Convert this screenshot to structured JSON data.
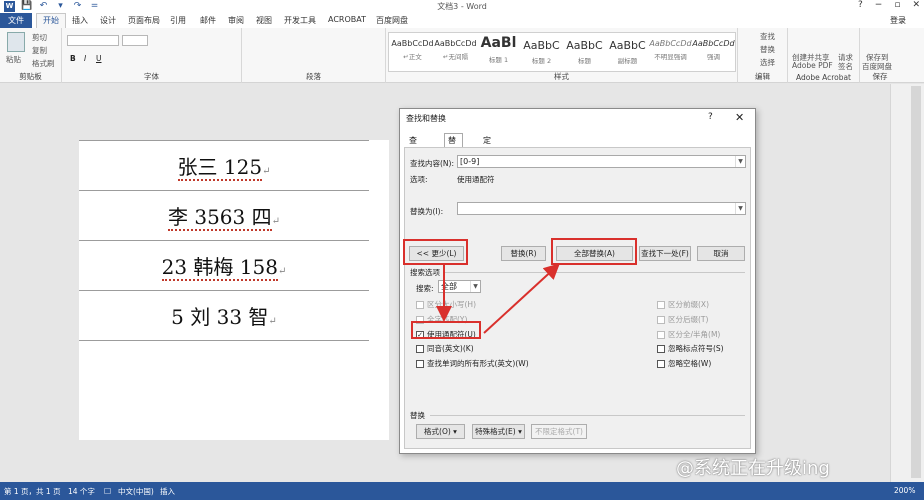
{
  "window": {
    "title": "文档3 - Word",
    "help": "?",
    "minimize": "−",
    "restore": "▫",
    "close": "✕"
  },
  "qat": {
    "word_icon": "W",
    "save": "💾",
    "undo": "↶",
    "undo_drop": "▾",
    "redo": "↷",
    "customize": "="
  },
  "tabs": {
    "file": "文件",
    "home": "开始",
    "insert": "插入",
    "design": "设计",
    "layout": "页面布局",
    "references": "引用",
    "mailings": "邮件",
    "review": "审阅",
    "view": "视图",
    "developer": "开发工具",
    "acrobat": "ACROBAT",
    "baidu": "百度网盘",
    "login": "登录"
  },
  "ribbon": {
    "clipboard": {
      "paste": "粘贴",
      "cut": "剪切",
      "copy": "复制",
      "format_painter": "格式刷",
      "name": "剪贴板"
    },
    "font": {
      "name": "字体",
      "bold": "B",
      "italic": "I",
      "underline": "U"
    },
    "paragraph": {
      "name": "段落"
    },
    "styles": {
      "name": "样式",
      "items": [
        {
          "sample": "AaBbCcDd",
          "label": "↵正文"
        },
        {
          "sample": "AaBbCcDd",
          "label": "↵无间隔"
        },
        {
          "sample": "AaBl",
          "label": "标题 1"
        },
        {
          "sample": "AaBbC",
          "label": "标题 2"
        },
        {
          "sample": "AaBbC",
          "label": "标题"
        },
        {
          "sample": "AaBbC",
          "label": "副标题"
        },
        {
          "sample": "AaBbCcDd",
          "label": "不明显强调"
        },
        {
          "sample": "AaBbCcDd",
          "label": "强调"
        }
      ]
    },
    "editing": {
      "find": "查找",
      "replace": "替换",
      "select": "选择",
      "name": "编辑"
    },
    "adobe": {
      "create_share": "创建并共享",
      "adobe_pdf": "Adobe PDF",
      "request": "请求",
      "sign": "签名",
      "name": "Adobe Acrobat"
    },
    "save": {
      "save_to": "保存到",
      "baidu": "百度网盘",
      "name": "保存"
    }
  },
  "document": {
    "rows": [
      "张三 125",
      "李 3563 四",
      "23 韩梅 158",
      "5 刘 33 智"
    ],
    "para_mark": "↵"
  },
  "dialog": {
    "title": "查找和替换",
    "help": "?",
    "close": "✕",
    "tabs": [
      "查找(D)",
      "替换(P)",
      "定位(G)"
    ],
    "find_label": "查找内容(N):",
    "find_value": "[0-9]",
    "options_label": "选项:",
    "options_value": "使用通配符",
    "replace_label": "替换为(I):",
    "replace_value": "",
    "less_button": "<< 更少(L)",
    "replace_button": "替换(R)",
    "replace_all_button": "全部替换(A)",
    "find_next_button": "查找下一处(F)",
    "cancel_button": "取消",
    "search_options_title": "搜索选项",
    "search_label": "搜索:",
    "search_value": "全部",
    "left_options": [
      {
        "label": "区分大小写(H)",
        "checked": false,
        "disabled": true
      },
      {
        "label": "全字匹配(Y)",
        "checked": false,
        "disabled": true
      },
      {
        "label": "使用通配符(U)",
        "checked": true,
        "disabled": false
      },
      {
        "label": "同音(英文)(K)",
        "checked": false,
        "disabled": false
      },
      {
        "label": "查找单词的所有形式(英文)(W)",
        "checked": false,
        "disabled": false
      }
    ],
    "right_options": [
      {
        "label": "区分前缀(X)",
        "checked": false,
        "disabled": true
      },
      {
        "label": "区分后缀(T)",
        "checked": false,
        "disabled": true
      },
      {
        "label": "区分全/半角(M)",
        "checked": false,
        "disabled": true
      },
      {
        "label": "忽略标点符号(S)",
        "checked": false,
        "disabled": false
      },
      {
        "label": "忽略空格(W)",
        "checked": false,
        "disabled": false
      }
    ],
    "replace_section_title": "替换",
    "format_button": "格式(O) ▾",
    "special_button": "特殊格式(E) ▾",
    "no_format_button": "不限定格式(T)"
  },
  "status": {
    "page": "第 1 页，共 1 页",
    "words": "14 个字",
    "proofing": "□",
    "language": "中文(中国)",
    "insert_mode": "插入",
    "zoom": "200%"
  },
  "watermark": "@系统正在升级ing",
  "colors": {
    "accent": "#2b579a",
    "annotation": "#d9302c"
  }
}
